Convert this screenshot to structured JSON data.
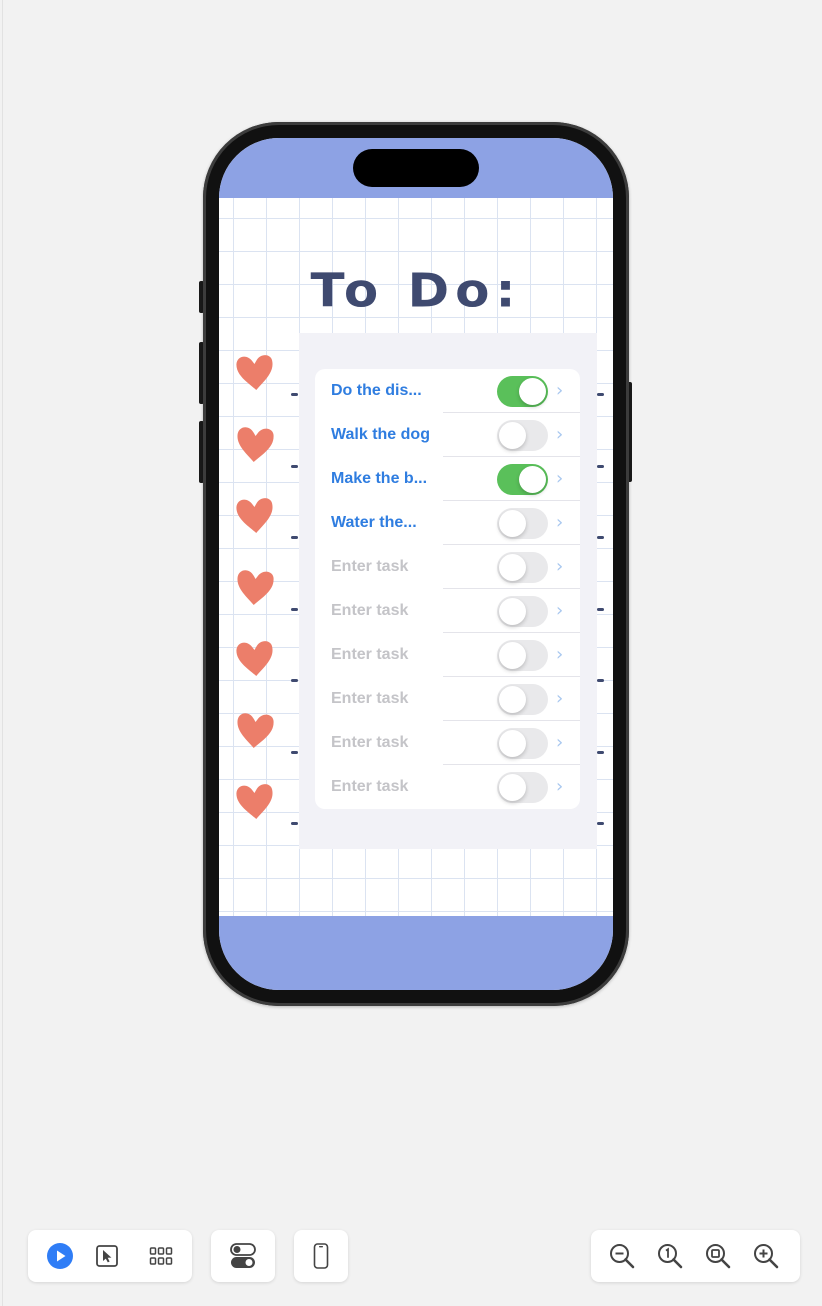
{
  "app": {
    "title": "To Do:",
    "accent_color": "#8da2e4",
    "heart_color": "#ec7e6a"
  },
  "tasks": [
    {
      "text": "Do the dis...",
      "placeholder": "",
      "done": true
    },
    {
      "text": "Walk the dog",
      "placeholder": "",
      "done": false
    },
    {
      "text": "Make the b...",
      "placeholder": "",
      "done": true
    },
    {
      "text": "Water the...",
      "placeholder": "",
      "done": false
    },
    {
      "text": "",
      "placeholder": "Enter task",
      "done": false
    },
    {
      "text": "",
      "placeholder": "Enter task",
      "done": false
    },
    {
      "text": "",
      "placeholder": "Enter task",
      "done": false
    },
    {
      "text": "",
      "placeholder": "Enter task",
      "done": false
    },
    {
      "text": "",
      "placeholder": "Enter task",
      "done": false
    },
    {
      "text": "",
      "placeholder": "Enter task",
      "done": false
    }
  ],
  "toolbar": {
    "left": [
      {
        "name": "live-preview-button",
        "icon": "play-icon"
      },
      {
        "name": "selectable-button",
        "icon": "cursor-icon"
      },
      {
        "name": "variants-button",
        "icon": "grid-icon"
      }
    ],
    "middle": [
      {
        "name": "device-settings-button",
        "icon": "toggles-icon"
      }
    ],
    "device": [
      {
        "name": "device-button",
        "icon": "iphone-icon"
      }
    ],
    "zoom": [
      {
        "name": "zoom-out-button",
        "icon": "zoom-out-icon"
      },
      {
        "name": "zoom-100-button",
        "icon": "zoom-actual-icon"
      },
      {
        "name": "zoom-fit-button",
        "icon": "zoom-fit-icon"
      },
      {
        "name": "zoom-in-button",
        "icon": "zoom-in-icon"
      }
    ]
  }
}
